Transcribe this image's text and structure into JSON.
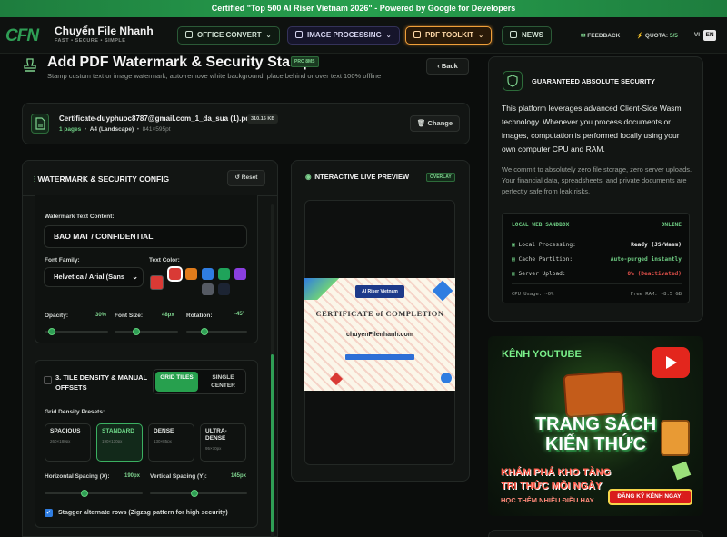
{
  "banner": "Certified \"Top 500 AI Riser Vietnam 2026\" - Powered by Google for Developers",
  "brand": {
    "logo": "CFN",
    "name": "Chuyển File Nhanh",
    "tagline": "FAST • SECURE • SIMPLE"
  },
  "nav": [
    {
      "label": "OFFICE CONVERT"
    },
    {
      "label": "IMAGE PROCESSING"
    },
    {
      "label": "PDF TOOLKIT"
    },
    {
      "label": "NEWS"
    }
  ],
  "topbar": {
    "feedback": "FEEDBACK",
    "quota": "QUOTA:",
    "quota_value": "5/5",
    "lang_vi": "VI",
    "lang_en": "EN"
  },
  "page": {
    "title": "Add PDF Watermark & Security Stamp",
    "badge": "PRO 8MS",
    "subtitle": "Stamp custom text or image watermark, auto-remove white background, place behind or over text 100% offline",
    "back_label": "Back"
  },
  "file": {
    "name": "Certificate-duyphuoc8787@gmail.com_1_da_sua (1).pdf",
    "size": "310.16 KB",
    "pages": "1 pages",
    "format": "A4 (Landscape)",
    "dims": "841×595pt",
    "change_label": "Change"
  },
  "config": {
    "title": "WATERMARK & SECURITY CONFIG",
    "reset_label": "Reset",
    "text_label": "Watermark Text Content:",
    "text_value": "BAO MAT / CONFIDENTIAL",
    "font_label": "Font Family:",
    "font_value": "Helvetica / Arial (Sans",
    "color_label": "Text Color:",
    "colors": [
      "#d93a35",
      "#e07b1b",
      "#2f7de1",
      "#1fa35a",
      "#8a3fe0",
      "#555a63",
      "#1c2433"
    ],
    "current_color": "#d93a35",
    "opacity_label": "Opacity:",
    "opacity_value": "30%",
    "opacity": 0.3,
    "fontsize_label": "Font Size:",
    "fontsize_value": "48px",
    "fontsize": 48,
    "rotation_label": "Rotation:",
    "rotation_value": "-45°",
    "rotation": -45
  },
  "tile": {
    "title": "3. TILE DENSITY & MANUAL OFFSETS",
    "mode_grid": "GRID TILES",
    "mode_single": "SINGLE CENTER",
    "presets_label": "Grid Density Presets:",
    "presets": [
      {
        "name": "SPACIOUS",
        "desc": "260×180px"
      },
      {
        "name": "STANDARD",
        "desc": "190×130px"
      },
      {
        "name": "DENSE",
        "desc": "130×85px"
      },
      {
        "name": "ULTRA-DENSE",
        "desc": "95×70px"
      }
    ],
    "h_label": "Horizontal Spacing (X):",
    "h_value": "190px",
    "h_spacing": 190,
    "v_label": "Vertical Spacing (Y):",
    "v_value": "145px",
    "v_spacing": 145,
    "stagger_label": "Stagger alternate rows (Zigzag pattern for high security)"
  },
  "preview": {
    "title": "INTERACTIVE LIVE PREVIEW",
    "badge": "OVERLAY",
    "cert_heading": "CERTIFICATE of COMPLETION",
    "cert_site": "chuyenFilenhanh.com",
    "cert_org": "AI Riser Vietnam"
  },
  "security": {
    "title": "GUARANTEED ABSOLUTE SECURITY",
    "p1": "This platform leverages advanced Client-Side Wasm technology. Whenever you process documents or images, computation is performed locally using your own computer CPU and RAM.",
    "p2": "We commit to absolutely zero file storage, zero server uploads. Your financial data, spreadsheets, and private documents are perfectly safe from leak risks.",
    "sandbox_label": "LOCAL WEB SANDBOX",
    "sandbox_status": "ONLINE",
    "rows": [
      {
        "label": "Local Processing:",
        "value": "Ready (JS/Wasm)"
      },
      {
        "label": "Cache Partition:",
        "value": "Auto-purged instantly"
      },
      {
        "label": "Server Upload:",
        "value": "0% (Deactivated)"
      }
    ],
    "cpu": "CPU Usage: ~0%",
    "ram": "Free RAM: ~8.5 GB"
  },
  "youtube": {
    "channel": "KÊNH YOUTUBE",
    "title1": "TRANG SÁCH",
    "title2": "KIẾN THỨC",
    "sub1": "KHÁM PHÁ KHO TÀNG",
    "sub2": "TRI THỨC MỖI NGÀY",
    "sub3": "HỌC THÊM NHIỀU ĐIỀU HAY",
    "cta": "ĐĂNG KÝ KÊNH NGAY!"
  }
}
